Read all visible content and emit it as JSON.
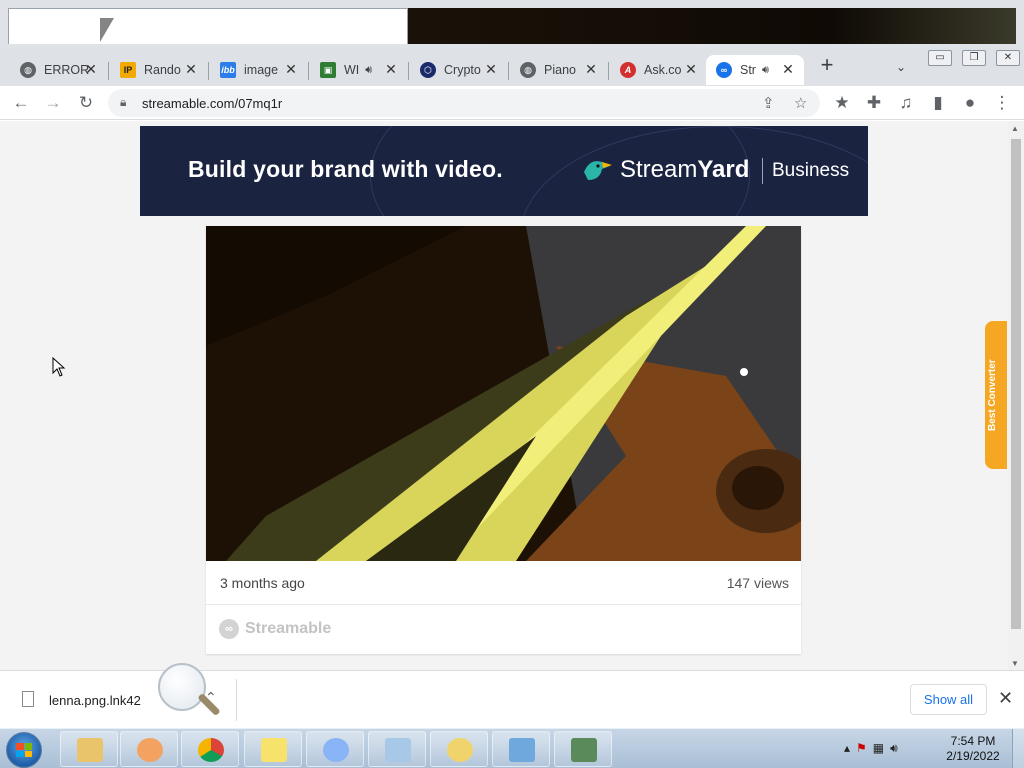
{
  "browser": {
    "tabs": [
      {
        "label": "ERROR",
        "favicon": "globe-icon",
        "audio": false
      },
      {
        "label": "Rando",
        "favicon": "ip-icon",
        "audio": false
      },
      {
        "label": "image",
        "favicon": "ibb-icon",
        "audio": false
      },
      {
        "label": "WI",
        "favicon": "game-icon",
        "audio": true
      },
      {
        "label": "Crypto",
        "favicon": "crypto-icon",
        "audio": false
      },
      {
        "label": "Piano",
        "favicon": "globe-icon",
        "audio": false
      },
      {
        "label": "Ask.co",
        "favicon": "ask-icon",
        "audio": false
      },
      {
        "label": "Str",
        "favicon": "streamable-icon",
        "audio": true,
        "active": true
      }
    ],
    "new_tab_label": "+",
    "url": "streamable.com/07mq1r"
  },
  "ad_banner": {
    "headline": "Build your brand with video.",
    "brand_light": "Stream",
    "brand_bold": "Yard",
    "suffix": "Business",
    "background_color": "#1a2340"
  },
  "video_card": {
    "uploaded": "3 months ago",
    "views": "147 views",
    "footer_brand": "Streamable"
  },
  "side_widget": {
    "label": "Best Converter"
  },
  "download_bar": {
    "file_name": "lenna.png.lnk42",
    "show_all": "Show all"
  },
  "taskbar": {
    "time": "7:54 PM",
    "date": "2/19/2022",
    "apps": [
      "explorer",
      "media-player",
      "chrome",
      "sticky-notes",
      "magnifier",
      "on-screen-keyboard",
      "speech",
      "photo-viewer",
      "task-manager"
    ]
  }
}
